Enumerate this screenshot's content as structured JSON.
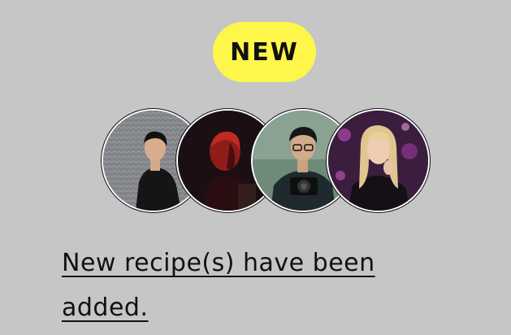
{
  "badge": {
    "label": "NEW",
    "color": "#fff64a"
  },
  "avatars": [
    {
      "name": "avatar-1"
    },
    {
      "name": "avatar-2"
    },
    {
      "name": "avatar-3"
    },
    {
      "name": "avatar-4"
    }
  ],
  "notification": {
    "message": "New recipe(s) have been added."
  },
  "colors": {
    "background": "#c6c6c6",
    "text": "#111111"
  }
}
